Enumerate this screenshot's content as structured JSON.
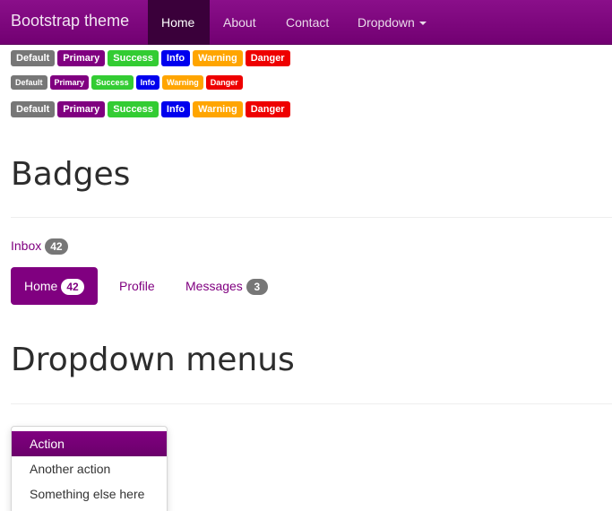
{
  "navbar": {
    "brand": "Bootstrap theme",
    "items": [
      "Home",
      "About",
      "Contact",
      "Dropdown"
    ],
    "active": "Home"
  },
  "labels": [
    "Default",
    "Primary",
    "Success",
    "Info",
    "Warning",
    "Danger"
  ],
  "colors": {
    "default": "#777777",
    "primary": "#800080",
    "success": "#33cc33",
    "info": "#0000ee",
    "warning": "#ffa500",
    "danger": "#ee0000"
  },
  "badges_section": {
    "title": "Badges",
    "inbox_label": "Inbox",
    "inbox_count": "42",
    "pills": [
      {
        "label": "Home",
        "count": "42"
      },
      {
        "label": "Profile"
      },
      {
        "label": "Messages",
        "count": "3"
      }
    ]
  },
  "dropdown_section": {
    "title": "Dropdown menus",
    "items": [
      "Action",
      "Another action",
      "Something else here"
    ],
    "active_item": "Action"
  }
}
